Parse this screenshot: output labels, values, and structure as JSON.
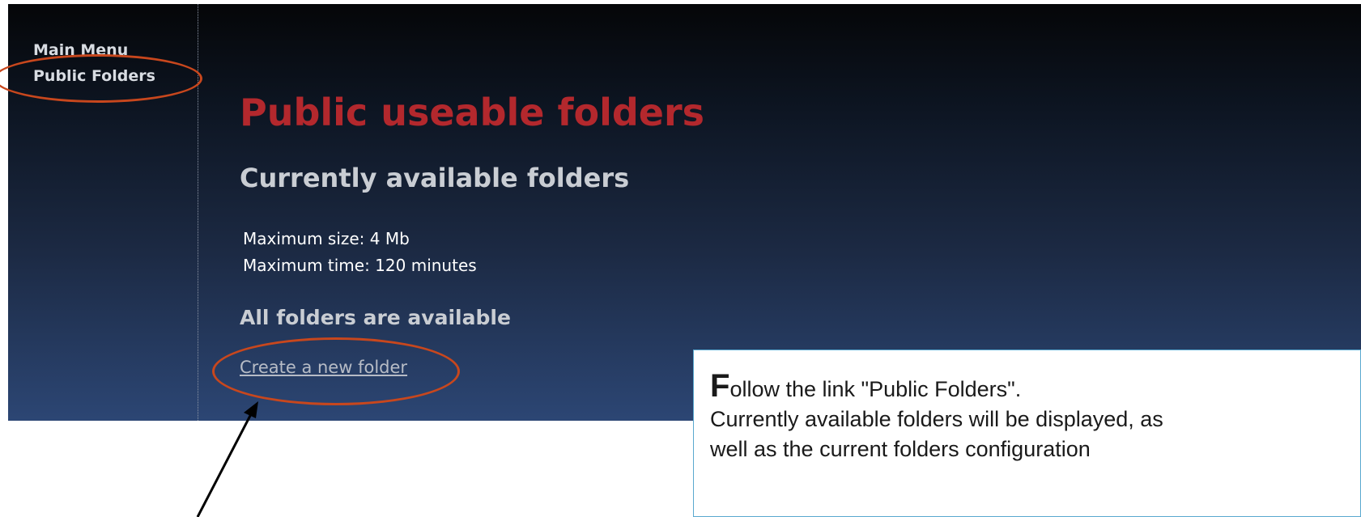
{
  "sidebar": {
    "items": [
      {
        "label": "Main Menu"
      },
      {
        "label": "Public Folders"
      }
    ]
  },
  "main": {
    "title": "Public useable folders",
    "section_title": "Currently available folders",
    "limits": {
      "max_size": "Maximum size: 4 Mb",
      "max_time": "Maximum time: 120 minutes"
    },
    "status": "All folders are available",
    "create_link": "Create a new folder"
  },
  "callout": {
    "dropcap": "F",
    "line1_rest": "ollow the link \"Public Folders\".",
    "line2": "Currently available folders will be displayed, as",
    "line3": "well as the current folders configuration"
  },
  "colors": {
    "title_red": "#b3282d",
    "annotation_orange": "#c8471d",
    "callout_border": "#5aa9cf"
  }
}
